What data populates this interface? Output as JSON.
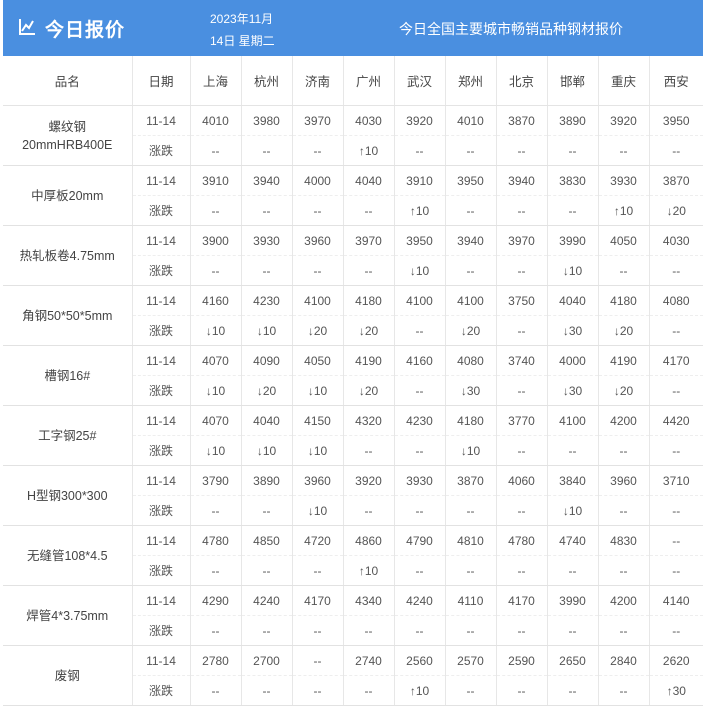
{
  "header": {
    "title": "今日报价",
    "date_line1": "2023年11月",
    "date_line2": "14日 星期二",
    "subtitle": "今日全国主要城市畅销品种钢材报价"
  },
  "columns": [
    "品名",
    "日期",
    "上海",
    "杭州",
    "济南",
    "广州",
    "武汉",
    "郑州",
    "北京",
    "邯郸",
    "重庆",
    "西安"
  ],
  "change_label": "涨跌",
  "products": [
    {
      "name_lines": [
        "螺纹钢",
        "20mmHRB400E"
      ],
      "date": "11-14",
      "prices": [
        "4010",
        "3980",
        "3970",
        "4030",
        "3920",
        "4010",
        "3870",
        "3890",
        "3920",
        "3950"
      ],
      "changes": [
        "--",
        "--",
        "--",
        "↑10",
        "--",
        "--",
        "--",
        "--",
        "--",
        "--"
      ]
    },
    {
      "name_lines": [
        "中厚板20mm"
      ],
      "date": "11-14",
      "prices": [
        "3910",
        "3940",
        "4000",
        "4040",
        "3910",
        "3950",
        "3940",
        "3830",
        "3930",
        "3870"
      ],
      "changes": [
        "--",
        "--",
        "--",
        "--",
        "↑10",
        "--",
        "--",
        "--",
        "↑10",
        "↓20"
      ]
    },
    {
      "name_lines": [
        "热轧板卷4.75mm"
      ],
      "date": "11-14",
      "prices": [
        "3900",
        "3930",
        "3960",
        "3970",
        "3950",
        "3940",
        "3970",
        "3990",
        "4050",
        "4030"
      ],
      "changes": [
        "--",
        "--",
        "--",
        "--",
        "↓10",
        "--",
        "--",
        "↓10",
        "--",
        "--"
      ]
    },
    {
      "name_lines": [
        "角钢50*50*5mm"
      ],
      "date": "11-14",
      "prices": [
        "4160",
        "4230",
        "4100",
        "4180",
        "4100",
        "4100",
        "3750",
        "4040",
        "4180",
        "4080"
      ],
      "changes": [
        "↓10",
        "↓10",
        "↓20",
        "↓20",
        "--",
        "↓20",
        "--",
        "↓30",
        "↓20",
        "--"
      ]
    },
    {
      "name_lines": [
        "槽钢16#"
      ],
      "date": "11-14",
      "prices": [
        "4070",
        "4090",
        "4050",
        "4190",
        "4160",
        "4080",
        "3740",
        "4000",
        "4190",
        "4170"
      ],
      "changes": [
        "↓10",
        "↓20",
        "↓10",
        "↓20",
        "--",
        "↓30",
        "--",
        "↓30",
        "↓20",
        "--"
      ]
    },
    {
      "name_lines": [
        "工字钢25#"
      ],
      "date": "11-14",
      "prices": [
        "4070",
        "4040",
        "4150",
        "4320",
        "4230",
        "4180",
        "3770",
        "4100",
        "4200",
        "4420"
      ],
      "changes": [
        "↓10",
        "↓10",
        "↓10",
        "--",
        "--",
        "↓10",
        "--",
        "--",
        "--",
        "--"
      ]
    },
    {
      "name_lines": [
        "H型钢300*300"
      ],
      "date": "11-14",
      "prices": [
        "3790",
        "3890",
        "3960",
        "3920",
        "3930",
        "3870",
        "4060",
        "3840",
        "3960",
        "3710"
      ],
      "changes": [
        "--",
        "--",
        "↓10",
        "--",
        "--",
        "--",
        "--",
        "↓10",
        "--",
        "--"
      ]
    },
    {
      "name_lines": [
        "无缝管108*4.5"
      ],
      "date": "11-14",
      "prices": [
        "4780",
        "4850",
        "4720",
        "4860",
        "4790",
        "4810",
        "4780",
        "4740",
        "4830",
        "--"
      ],
      "changes": [
        "--",
        "--",
        "--",
        "↑10",
        "--",
        "--",
        "--",
        "--",
        "--",
        "--"
      ]
    },
    {
      "name_lines": [
        "焊管4*3.75mm"
      ],
      "date": "11-14",
      "prices": [
        "4290",
        "4240",
        "4170",
        "4340",
        "4240",
        "4110",
        "4170",
        "3990",
        "4200",
        "4140"
      ],
      "changes": [
        "--",
        "--",
        "--",
        "--",
        "--",
        "--",
        "--",
        "--",
        "--",
        "--"
      ]
    },
    {
      "name_lines": [
        "废钢"
      ],
      "date": "11-14",
      "prices": [
        "2780",
        "2700",
        "--",
        "2740",
        "2560",
        "2570",
        "2590",
        "2650",
        "2840",
        "2620"
      ],
      "changes": [
        "--",
        "--",
        "--",
        "--",
        "↑10",
        "--",
        "--",
        "--",
        "--",
        "↑30"
      ]
    }
  ],
  "colors": {
    "header_bg": "#4a8fe0",
    "up": "#e8383d",
    "down": "#2bb34b"
  }
}
